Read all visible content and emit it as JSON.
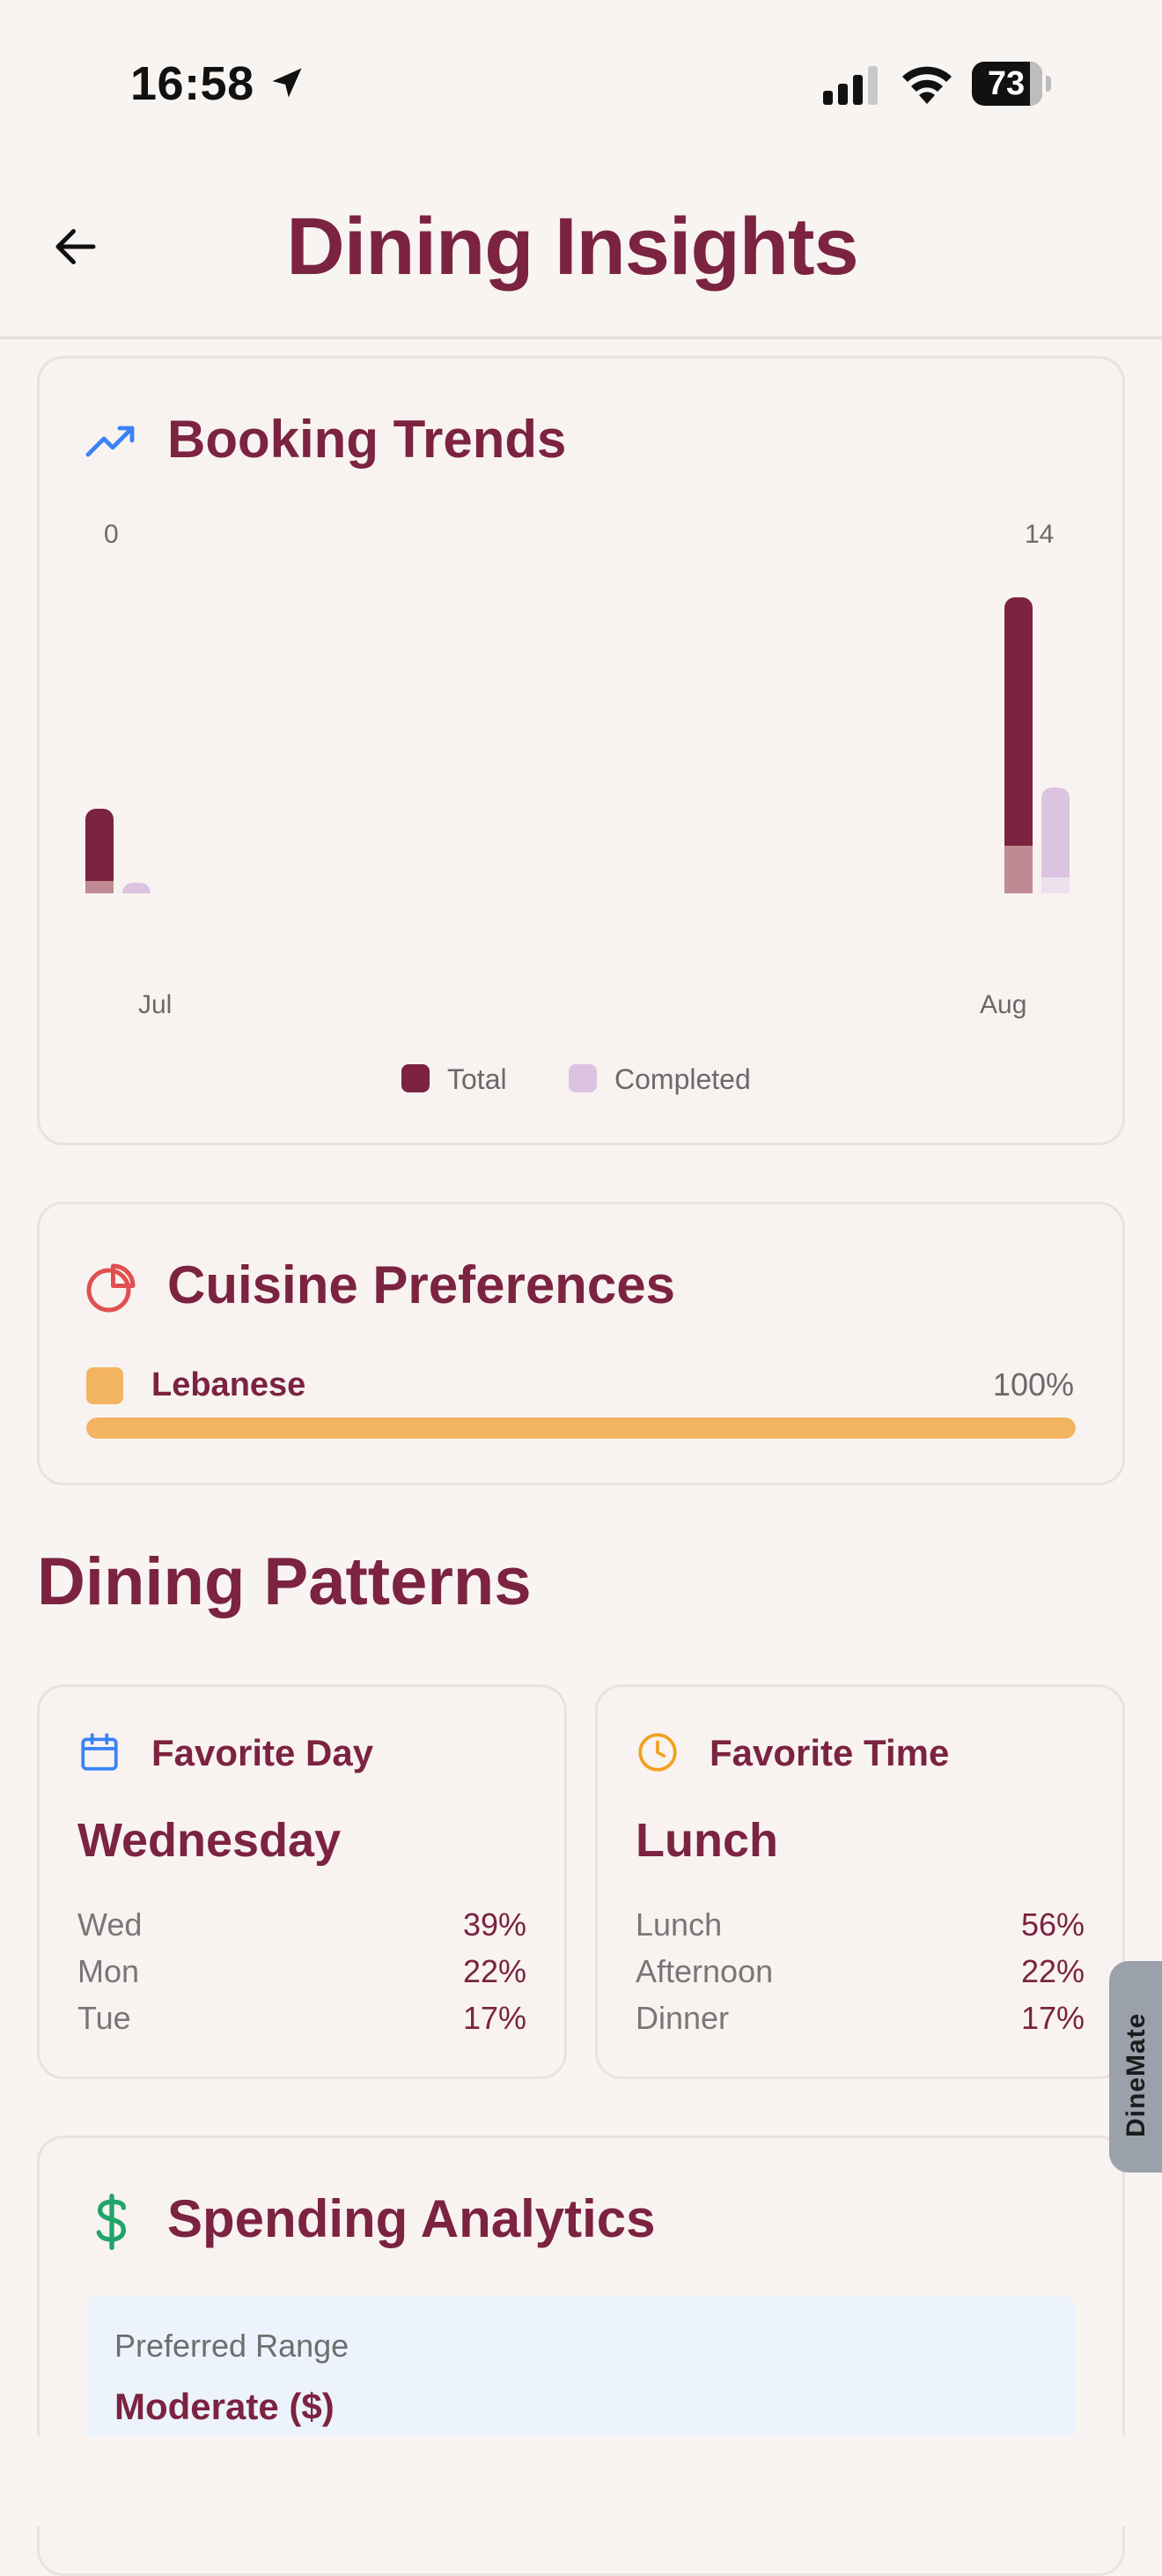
{
  "status_bar": {
    "time": "16:58",
    "battery": "73"
  },
  "header": {
    "title": "Dining Insights"
  },
  "booking_trends": {
    "title": "Booking Trends"
  },
  "chart_data": {
    "type": "bar",
    "categories": [
      "Jul",
      "Aug"
    ],
    "series": [
      {
        "name": "Total",
        "values": [
          4,
          14
        ],
        "color": "#7b2340"
      },
      {
        "name": "Completed",
        "values": [
          0.5,
          5
        ],
        "color": "#dcc3e0"
      }
    ],
    "tick_labels": [
      "0",
      "14"
    ],
    "ylim": [
      0,
      14
    ],
    "legend": "bottom"
  },
  "legend": {
    "total": "Total",
    "completed": "Completed"
  },
  "cuisine": {
    "title": "Cuisine Preferences",
    "items": [
      {
        "name": "Lebanese",
        "percent_label": "100%",
        "fraction": 1.0,
        "color": "#f3b462"
      }
    ]
  },
  "dining_patterns": {
    "title": "Dining Patterns",
    "favorite_day": {
      "label": "Favorite Day",
      "value": "Wednesday",
      "rows": [
        {
          "label": "Wed",
          "value": "39%"
        },
        {
          "label": "Mon",
          "value": "22%"
        },
        {
          "label": "Tue",
          "value": "17%"
        }
      ]
    },
    "favorite_time": {
      "label": "Favorite Time",
      "value": "Lunch",
      "rows": [
        {
          "label": "Lunch",
          "value": "56%"
        },
        {
          "label": "Afternoon",
          "value": "22%"
        },
        {
          "label": "Dinner",
          "value": "17%"
        }
      ]
    }
  },
  "spending": {
    "title": "Spending Analytics",
    "range_label": "Preferred Range",
    "range_value": "Moderate ($)"
  },
  "side_tab": {
    "label": "DineMate"
  },
  "icons": {
    "back": "arrow-left-icon",
    "trend": "trending-up-icon",
    "pie": "pie-chart-icon",
    "calendar": "calendar-icon",
    "clock": "clock-icon",
    "dollar": "dollar-icon"
  }
}
